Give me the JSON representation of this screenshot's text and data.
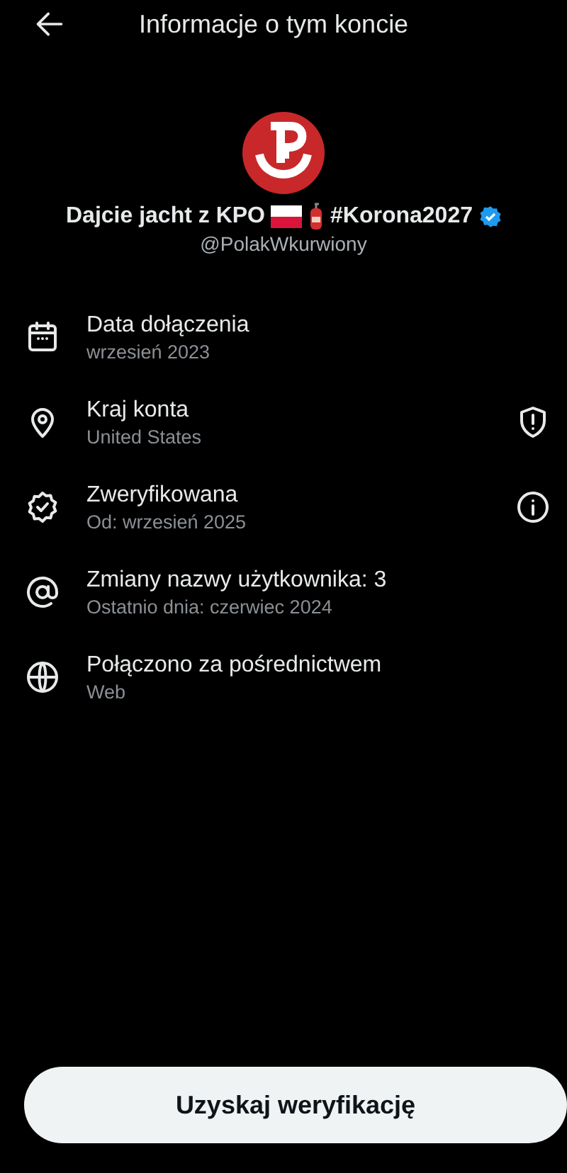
{
  "header": {
    "title": "Informacje o tym koncie"
  },
  "profile": {
    "name_parts": [
      {
        "kind": "text",
        "text": "Dajcie jacht z KPO"
      },
      {
        "kind": "flag"
      },
      {
        "kind": "extinguisher"
      },
      {
        "kind": "text",
        "text": "#Korona2027"
      }
    ],
    "verified": true,
    "handle": "@PolakWkurwiony"
  },
  "rows": [
    {
      "kind": "calendar",
      "title": "Data dołączenia",
      "subtitle": "wrzesień 2023"
    },
    {
      "kind": "location",
      "title": "Kraj konta",
      "subtitle": "United States",
      "trailing": {
        "kind": "shield"
      }
    },
    {
      "kind": "verified",
      "title": "Zweryfikowana",
      "subtitle": "Od: wrzesień 2025",
      "trailing": {
        "kind": "info"
      }
    },
    {
      "kind": "at",
      "title": "Zmiany nazwy użytkownika: 3",
      "subtitle": "Ostatnio dnia: czerwiec 2024"
    },
    {
      "kind": "globe",
      "title": "Połączono za pośrednictwem",
      "subtitle": "Web"
    }
  ],
  "button": {
    "label": "Uzyskaj weryfikację"
  }
}
